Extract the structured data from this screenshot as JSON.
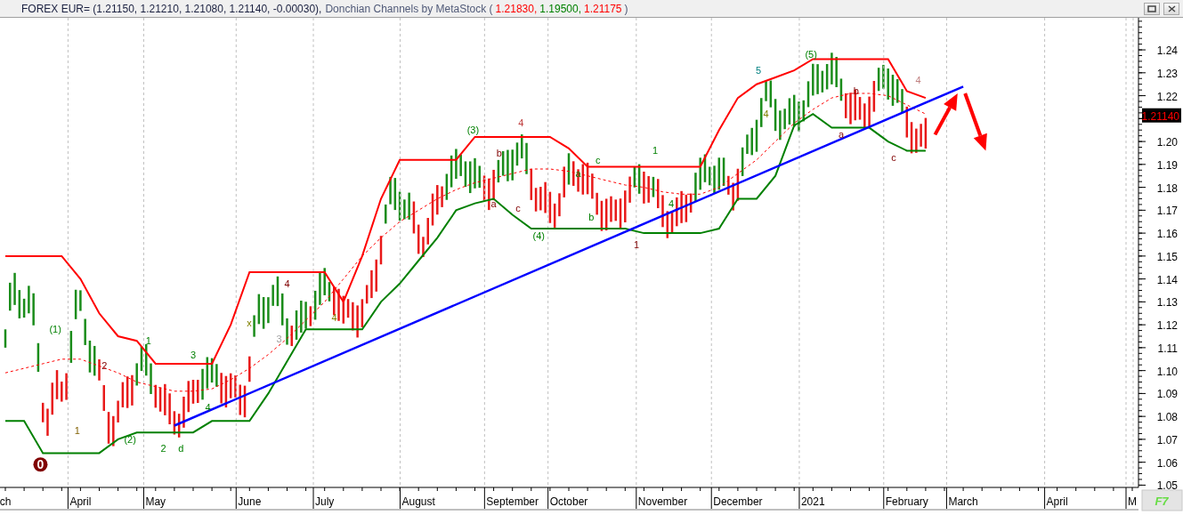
{
  "window": {
    "symbol_quote": "FOREX EUR= (1.21150, 1.21210, 1.21080, 1.21140, -0.00030),",
    "indicator": "Donchian Channels by MetaStock (",
    "indicator_values": [
      {
        "text": "1.21830,",
        "color": "#ff0000"
      },
      {
        "text": "1.19500,",
        "color": "#008000"
      },
      {
        "text": "1.21175",
        "color": "#ff0000"
      }
    ],
    "indicator_end": ")"
  },
  "last_price": "1.21140",
  "corner_button": "F7",
  "chart": {
    "chart_data": {
      "type": "line",
      "grid": true,
      "ylim": [
        1.049,
        1.254
      ],
      "categories": [
        "ch",
        null,
        null,
        null,
        "April",
        null,
        null,
        null,
        "May",
        null,
        null,
        null,
        null,
        "June",
        null,
        null,
        null,
        "July",
        null,
        null,
        null,
        null,
        "August",
        null,
        null,
        null,
        null,
        "September",
        null,
        null,
        "October",
        null,
        null,
        null,
        null,
        "November",
        null,
        null,
        null,
        "December",
        null,
        null,
        null,
        "2021",
        null,
        null,
        null,
        null,
        "February",
        null,
        null,
        "March",
        null,
        null,
        null,
        null,
        "April",
        null,
        null,
        null,
        "M"
      ],
      "series": [
        {
          "color": "#ff0000",
          "values": [
            1.15,
            1.15,
            1.15,
            1.15,
            1.14,
            1.125,
            1.115,
            1.113,
            1.103,
            1.103,
            1.103,
            1.103,
            1.12,
            1.143,
            1.143,
            1.143,
            1.143,
            1.143,
            1.13,
            1.15,
            1.175,
            1.192,
            1.192,
            1.192,
            1.192,
            1.202,
            1.202,
            1.202,
            1.202,
            1.202,
            1.197,
            1.189,
            1.189,
            1.189,
            1.189,
            1.189,
            1.189,
            1.189,
            1.205,
            1.219,
            1.225,
            1.228,
            1.231,
            1.236,
            1.236,
            1.236,
            1.236,
            1.236,
            1.222,
            1.219,
            null,
            null,
            null,
            null,
            null,
            null,
            null,
            null,
            null,
            null,
            null
          ]
        },
        {
          "color": "#008000",
          "values": [
            1.078,
            1.078,
            1.064,
            1.064,
            1.064,
            1.064,
            1.07,
            1.073,
            1.073,
            1.073,
            1.073,
            1.078,
            1.078,
            1.078,
            1.09,
            1.104,
            1.118,
            1.118,
            1.118,
            1.118,
            1.13,
            1.138,
            1.148,
            1.158,
            1.17,
            1.173,
            1.175,
            1.168,
            1.162,
            1.162,
            1.162,
            1.162,
            1.162,
            1.162,
            1.16,
            1.16,
            1.16,
            1.16,
            1.162,
            1.175,
            1.175,
            1.185,
            1.207,
            1.212,
            1.206,
            1.206,
            1.206,
            1.2,
            1.196,
            1.196,
            null,
            null,
            null,
            null,
            null,
            null,
            null,
            null,
            null,
            null,
            null
          ]
        },
        {
          "color": "#ff0000",
          "line_style": "dashed",
          "values": [
            1.099,
            1.101,
            1.103,
            1.105,
            1.105,
            1.102,
            1.099,
            1.095,
            1.093,
            1.091,
            1.091,
            1.092,
            1.096,
            1.101,
            1.107,
            1.114,
            1.122,
            1.13,
            1.14,
            1.15,
            1.158,
            1.165,
            1.17,
            1.175,
            1.179,
            1.182,
            1.184,
            1.186,
            1.188,
            1.188,
            1.187,
            1.185,
            1.183,
            1.181,
            1.18,
            1.178,
            1.177,
            1.177,
            1.18,
            1.186,
            1.192,
            1.2,
            1.208,
            1.214,
            1.219,
            1.221,
            1.221,
            1.22,
            1.216,
            1.212,
            null,
            null,
            null,
            null,
            null,
            null,
            null,
            null,
            null,
            null,
            null
          ]
        },
        {
          "color": "#0000ff",
          "values": [
            null,
            null,
            null,
            null,
            null,
            null,
            null,
            null,
            null,
            1.076,
            null,
            null,
            null,
            null,
            null,
            null,
            null,
            null,
            null,
            null,
            null,
            null,
            null,
            null,
            null,
            null,
            null,
            null,
            null,
            null,
            null,
            null,
            null,
            null,
            null,
            null,
            null,
            null,
            null,
            null,
            null,
            null,
            null,
            null,
            null,
            null,
            null,
            null,
            null,
            null,
            null,
            1.224,
            null,
            null,
            null,
            null,
            null,
            null,
            null,
            null,
            null
          ]
        }
      ],
      "yticks": [
        {
          "value": 1.05,
          "label": "1.05"
        },
        {
          "value": 1.06,
          "label": "1.06"
        },
        {
          "value": 1.07,
          "label": "1.07"
        },
        {
          "value": 1.08,
          "label": "1.08"
        },
        {
          "value": 1.09,
          "label": "1.09"
        },
        {
          "value": 1.1,
          "label": "1.10"
        },
        {
          "value": 1.11,
          "label": "1.11"
        },
        {
          "value": 1.12,
          "label": "1.12"
        },
        {
          "value": 1.13,
          "label": "1.13"
        },
        {
          "value": 1.14,
          "label": "1.14"
        },
        {
          "value": 1.15,
          "label": "1.15"
        },
        {
          "value": 1.16,
          "label": "1.16"
        },
        {
          "value": 1.17,
          "label": "1.17"
        },
        {
          "value": 1.18,
          "label": "1.18"
        },
        {
          "value": 1.19,
          "label": "1.19"
        },
        {
          "value": 1.2,
          "label": "1.20"
        },
        {
          "value": 1.22,
          "label": "1.22"
        },
        {
          "value": 1.23,
          "label": "1.23"
        },
        {
          "value": 1.24,
          "label": "1.24"
        }
      ],
      "annotations": [
        "0",
        "(1)",
        "1",
        "2",
        "(2)",
        "1",
        "2",
        "d",
        "3",
        "4",
        "x",
        "3",
        "4",
        "4",
        "(3)",
        "a",
        "b",
        "c",
        "4",
        "(4)",
        "a",
        "b",
        "c",
        "1",
        "1",
        "4",
        "5",
        "4",
        "(5)",
        "a",
        "b",
        "c",
        "4"
      ]
    }
  }
}
